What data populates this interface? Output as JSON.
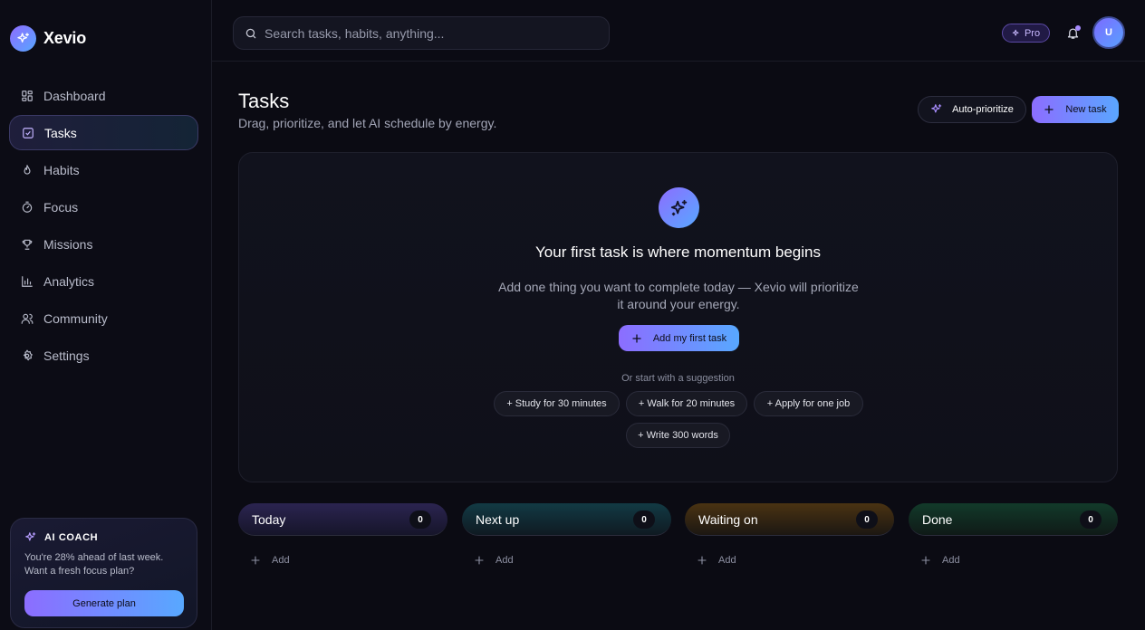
{
  "app": {
    "name": "Xevio"
  },
  "sidebar": {
    "items": [
      {
        "label": "Dashboard",
        "icon": "grid-icon"
      },
      {
        "label": "Tasks",
        "icon": "checkbox-icon",
        "active": true
      },
      {
        "label": "Habits",
        "icon": "flame-icon"
      },
      {
        "label": "Focus",
        "icon": "timer-icon"
      },
      {
        "label": "Missions",
        "icon": "trophy-icon"
      },
      {
        "label": "Analytics",
        "icon": "bar-chart-icon"
      },
      {
        "label": "Community",
        "icon": "users-icon"
      },
      {
        "label": "Settings",
        "icon": "gear-icon"
      }
    ],
    "coach": {
      "title": "AI COACH",
      "text": "You're 28% ahead of last week. Want a fresh focus plan?",
      "button": "Generate plan"
    }
  },
  "topbar": {
    "search_placeholder": "Search tasks, habits, anything...",
    "pro_label": "Pro",
    "avatar_initial": "U"
  },
  "page": {
    "title": "Tasks",
    "subtitle": "Drag, prioritize, and let AI schedule by energy.",
    "auto_prioritize": "Auto-prioritize",
    "new_task": "New task"
  },
  "empty": {
    "title": "Your first task is where momentum begins",
    "description": "Add one thing you want to complete today — Xevio will prioritize it around your energy.",
    "button": "Add my first task",
    "suggest_label": "Or start with a suggestion",
    "suggestions": [
      "+ Study for 30 minutes",
      "+ Walk for 20 minutes",
      "+ Apply for one job",
      "+ Write 300 words"
    ]
  },
  "columns": [
    {
      "title": "Today",
      "count": "0",
      "add": "Add",
      "color": "#6a4fd6"
    },
    {
      "title": "Next up",
      "count": "0",
      "add": "Add",
      "color": "#1a7e89"
    },
    {
      "title": "Waiting on",
      "count": "0",
      "add": "Add",
      "color": "#a86a12"
    },
    {
      "title": "Done",
      "count": "0",
      "add": "Add",
      "color": "#1a7a4c"
    }
  ],
  "colors": {
    "accent_start": "#8c6dff",
    "accent_end": "#58a8ff",
    "background": "#0b0b13"
  }
}
